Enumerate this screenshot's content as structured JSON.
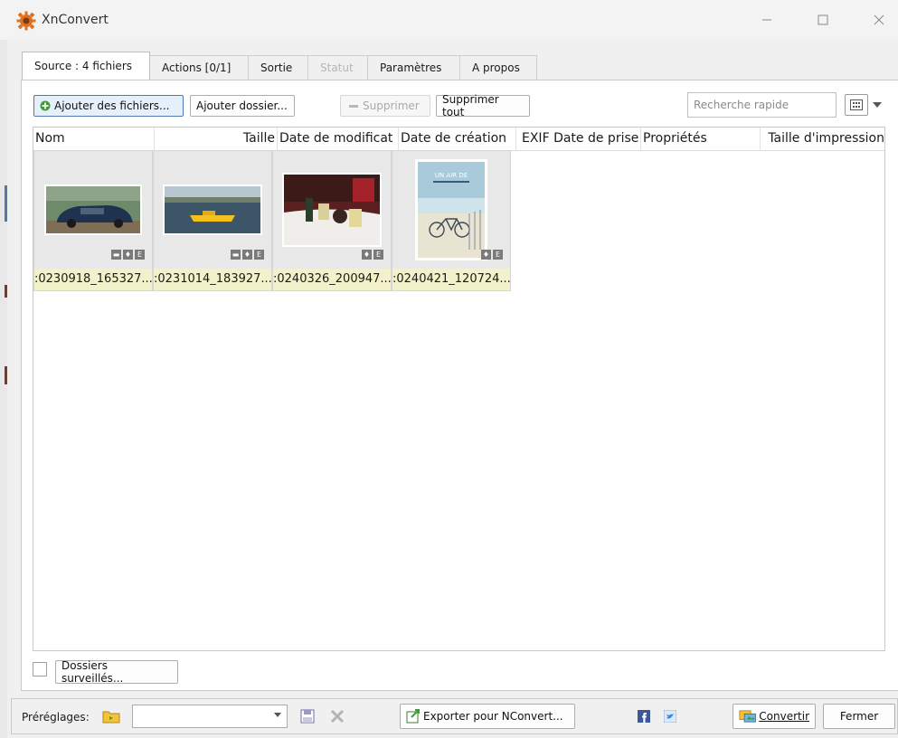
{
  "window": {
    "title": "XnConvert"
  },
  "tabs": [
    {
      "label": "Source : 4 fichiers",
      "active": true
    },
    {
      "label": "Actions [0/1]"
    },
    {
      "label": "Sortie"
    },
    {
      "label": "Statut",
      "disabled": true
    },
    {
      "label": "Paramètres"
    },
    {
      "label": "A propos"
    }
  ],
  "toolbar": {
    "add_files": "Ajouter des fichiers...",
    "add_folder": "Ajouter dossier...",
    "remove": "Supprimer",
    "remove_all": "Supprimer tout",
    "search_placeholder": "Recherche rapide"
  },
  "columns": [
    "Nom",
    "Taille",
    "Date de modificat",
    "Date de création",
    "EXIF Date de prise",
    "Propriétés",
    "Taille d'impression"
  ],
  "files": [
    {
      "name": ":0230918_165327...",
      "badges": [
        "▬",
        "♦",
        "E"
      ]
    },
    {
      "name": ":0231014_183927...",
      "badges": [
        "▬",
        "♦",
        "E"
      ]
    },
    {
      "name": ":0240326_200947...",
      "badges": [
        "♦",
        "E"
      ]
    },
    {
      "name": ":0240421_120724...",
      "badges": [
        "♦",
        "E"
      ]
    }
  ],
  "thumb_text": {
    "poster": "UN AIR DE"
  },
  "watched": {
    "label": "Dossiers surveillés..."
  },
  "bottom": {
    "presets_label": "Préréglages:",
    "export": "Exporter pour NConvert...",
    "convert": "Convertir",
    "close": "Fermer"
  }
}
